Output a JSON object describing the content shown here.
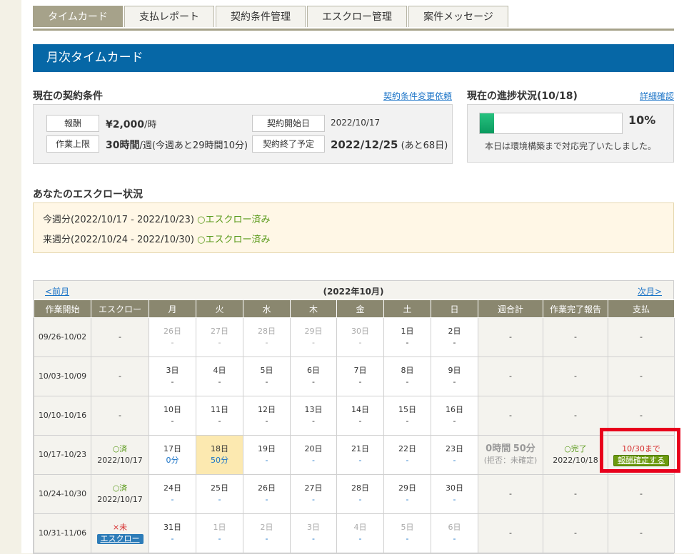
{
  "tabs": [
    "タイムカード",
    "支払レポート",
    "契約条件管理",
    "エスクロー管理",
    "案件メッセージ"
  ],
  "banner": "月次タイムカード",
  "contract": {
    "title": "現在の契約条件",
    "change_link": "契約条件変更依頼",
    "pay_label": "報酬",
    "pay_value": "¥2,000",
    "pay_unit": "/時",
    "limit_label": "作業上限",
    "limit_value": "30時間",
    "limit_unit": "/週(今週あと29時間10分)",
    "start_label": "契約開始日",
    "start_value": "2022/10/17",
    "end_label": "契約終了予定",
    "end_value": "2022/12/25",
    "end_note": "(あと68日)"
  },
  "progress": {
    "title": "現在の進捗状況(10/18)",
    "detail_link": "詳細確認",
    "percent": "10%",
    "fraction": 0.1,
    "note": "本日は環境構築まで対応完了いたしました。"
  },
  "escrow": {
    "title": "あなたのエスクロー状況",
    "line1_period": "今週分(2022/10/17 - 2022/10/23)",
    "line1_status": "○エスクロー済み",
    "line2_period": "来週分(2022/10/24 - 2022/10/30)",
    "line2_status": "○エスクロー済み"
  },
  "calendar": {
    "prev": "<前月",
    "next": "次月>",
    "month": "(2022年10月)",
    "headers": [
      "作業開始",
      "エスクロー",
      "月",
      "火",
      "水",
      "木",
      "金",
      "土",
      "日",
      "週合計",
      "作業完了報告",
      "支払"
    ],
    "rows": [
      {
        "week": "09/26-10/02",
        "escrow": "-",
        "days": [
          "26日",
          "27日",
          "28日",
          "29日",
          "30日",
          "1日",
          "2日"
        ],
        "vals": [
          "-",
          "-",
          "-",
          "-",
          "-",
          "-",
          "-"
        ],
        "total": "-",
        "report": "-",
        "pay": "-"
      },
      {
        "week": "10/03-10/09",
        "escrow": "-",
        "days": [
          "3日",
          "4日",
          "5日",
          "6日",
          "7日",
          "8日",
          "9日"
        ],
        "vals": [
          "-",
          "-",
          "-",
          "-",
          "-",
          "-",
          "-"
        ],
        "total": "-",
        "report": "-",
        "pay": "-"
      },
      {
        "week": "10/10-10/16",
        "escrow": "-",
        "days": [
          "10日",
          "11日",
          "12日",
          "13日",
          "14日",
          "15日",
          "16日"
        ],
        "vals": [
          "-",
          "-",
          "-",
          "-",
          "-",
          "-",
          "-"
        ],
        "total": "-",
        "report": "-",
        "pay": "-"
      },
      {
        "week": "10/17-10/23",
        "escrow": "○済",
        "escrow_date": "2022/10/17",
        "days": [
          "17日",
          "18日",
          "19日",
          "20日",
          "21日",
          "22日",
          "23日"
        ],
        "vals": [
          "0分",
          "50分",
          "-",
          "-",
          "-",
          "-",
          "-"
        ],
        "total_h": "0時間",
        "total_m": "50分",
        "total_note": "(拒否：未確定)",
        "report": "○完了",
        "report_date": "2022/10/18",
        "pay_deadline": "10/30まで",
        "pay_button": "報酬確定する"
      },
      {
        "week": "10/24-10/30",
        "escrow": "○済",
        "escrow_date": "2022/10/17",
        "days": [
          "24日",
          "25日",
          "26日",
          "27日",
          "28日",
          "29日",
          "30日"
        ],
        "vals": [
          "-",
          "-",
          "-",
          "-",
          "-",
          "-",
          "-"
        ],
        "total": "-",
        "report": "-",
        "pay": "-"
      },
      {
        "week": "10/31-11/06",
        "escrow": "×未",
        "escrow_button": "エスクロー",
        "days": [
          "31日",
          "1日",
          "2日",
          "3日",
          "4日",
          "5日",
          "6日"
        ],
        "vals": [
          "-",
          "-",
          "-",
          "-",
          "-",
          "-",
          "-"
        ],
        "total": "-",
        "report": "-",
        "pay": "-"
      }
    ]
  }
}
